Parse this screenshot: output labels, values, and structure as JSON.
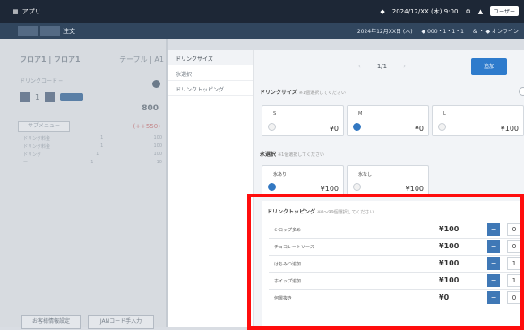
{
  "topbar": {
    "app_name": "アプリ",
    "right_text": "2024/12/XX (木) 9:00",
    "user_label": "ユーザー"
  },
  "subbar": {
    "order_label": "注文",
    "info_left": "2024年12月XX日 (木)",
    "info_mid": "◆ 000・1・1・1",
    "info_right": "& ・ ◆ オンライン"
  },
  "left_panel": {
    "floor": "フロア1 | フロア1",
    "table": "テーブル | A1",
    "menu_text": "ドリンクコード ─",
    "quantity": "1",
    "price": "800",
    "sub_button": "サブメニュー",
    "sub_price": "(++550)",
    "items": [
      {
        "name": "ドリンク料金",
        "qty": "1",
        "price": "100"
      },
      {
        "name": "ドリンク料金",
        "qty": "1",
        "price": "100"
      },
      {
        "name": "ドリンク",
        "qty": "1",
        "price": "100"
      },
      {
        "name": "ー",
        "qty": "1",
        "price": "10"
      }
    ],
    "btn_left": "お客様情報設定",
    "btn_right": "JANコード手入力"
  },
  "sidebar": {
    "items": [
      "ドリンクサイズ",
      "氷選択",
      "ドリンクトッピング"
    ]
  },
  "main": {
    "page_indicator": "1/1",
    "prev_arrow": "‹",
    "next_arrow": "›",
    "add_button": "追加",
    "size_section": {
      "title": "ドリンクサイズ",
      "hint": "※1個選択してください",
      "options": [
        {
          "name": "S",
          "price": "¥0",
          "selected": false
        },
        {
          "name": "M",
          "price": "¥0",
          "selected": true
        },
        {
          "name": "L",
          "price": "¥100",
          "selected": false
        }
      ]
    },
    "ice_section": {
      "title": "氷選択",
      "hint": "※1個選択してください",
      "options": [
        {
          "name": "氷あり",
          "price": "¥100",
          "selected": true
        },
        {
          "name": "氷なし",
          "price": "¥100",
          "selected": false
        }
      ]
    },
    "topping_section": {
      "title": "ドリンクトッピング",
      "hint": "※0～99個選択してください",
      "rows": [
        {
          "name": "シロップ多め",
          "price": "¥100",
          "qty": "0"
        },
        {
          "name": "チョコレートソース",
          "price": "¥100",
          "qty": "0"
        },
        {
          "name": "はちみつ追加",
          "price": "¥100",
          "qty": "1"
        },
        {
          "name": "ホイップ追加",
          "price": "¥100",
          "qty": "1"
        },
        {
          "name": "何層抜き",
          "price": "¥0",
          "qty": "0"
        }
      ],
      "minus_label": "−"
    }
  },
  "colors": {
    "accent": "#2e7bcc",
    "highlight": "#ff0d0d",
    "topbar": "#1d2736"
  }
}
